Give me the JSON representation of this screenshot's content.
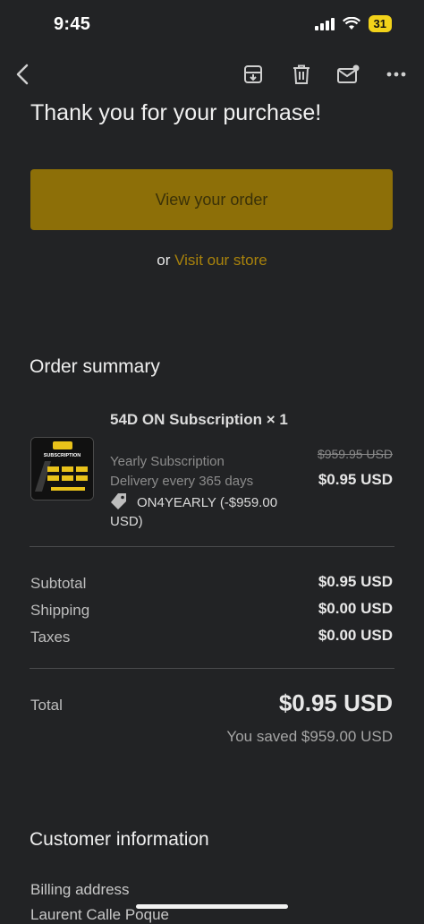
{
  "status_bar": {
    "time": "9:45",
    "battery": "31",
    "battery_color": "#f2d21a"
  },
  "toolbar": {
    "faded_title": ""
  },
  "email": {
    "heading": "Thank you for your purchase!",
    "view_order_label": "View your order",
    "store_prefix": "or",
    "store_link": "Visit our store",
    "accent": "#8d6f08"
  },
  "order_summary": {
    "title": "Order summary",
    "item": {
      "name": "54D ON Subscription × 1",
      "plan": "Yearly Subscription",
      "delivery": "Delivery every 365 days",
      "discount": "ON4YEARLY (-$959.00 USD)",
      "old_price": "$959.95 USD",
      "price": "$0.95 USD",
      "thumb_text": "SUBSCRIPTION"
    },
    "rows": [
      {
        "label": "Subtotal",
        "value": "$0.95 USD"
      },
      {
        "label": "Shipping",
        "value": "$0.00 USD"
      },
      {
        "label": "Taxes",
        "value": "$0.00 USD"
      }
    ],
    "total_label": "Total",
    "total_value": "$0.95 USD",
    "saved": "You saved $959.00 USD"
  },
  "customer": {
    "title": "Customer information",
    "billing_label": "Billing address",
    "billing_name": "Laurent Calle Poque"
  }
}
